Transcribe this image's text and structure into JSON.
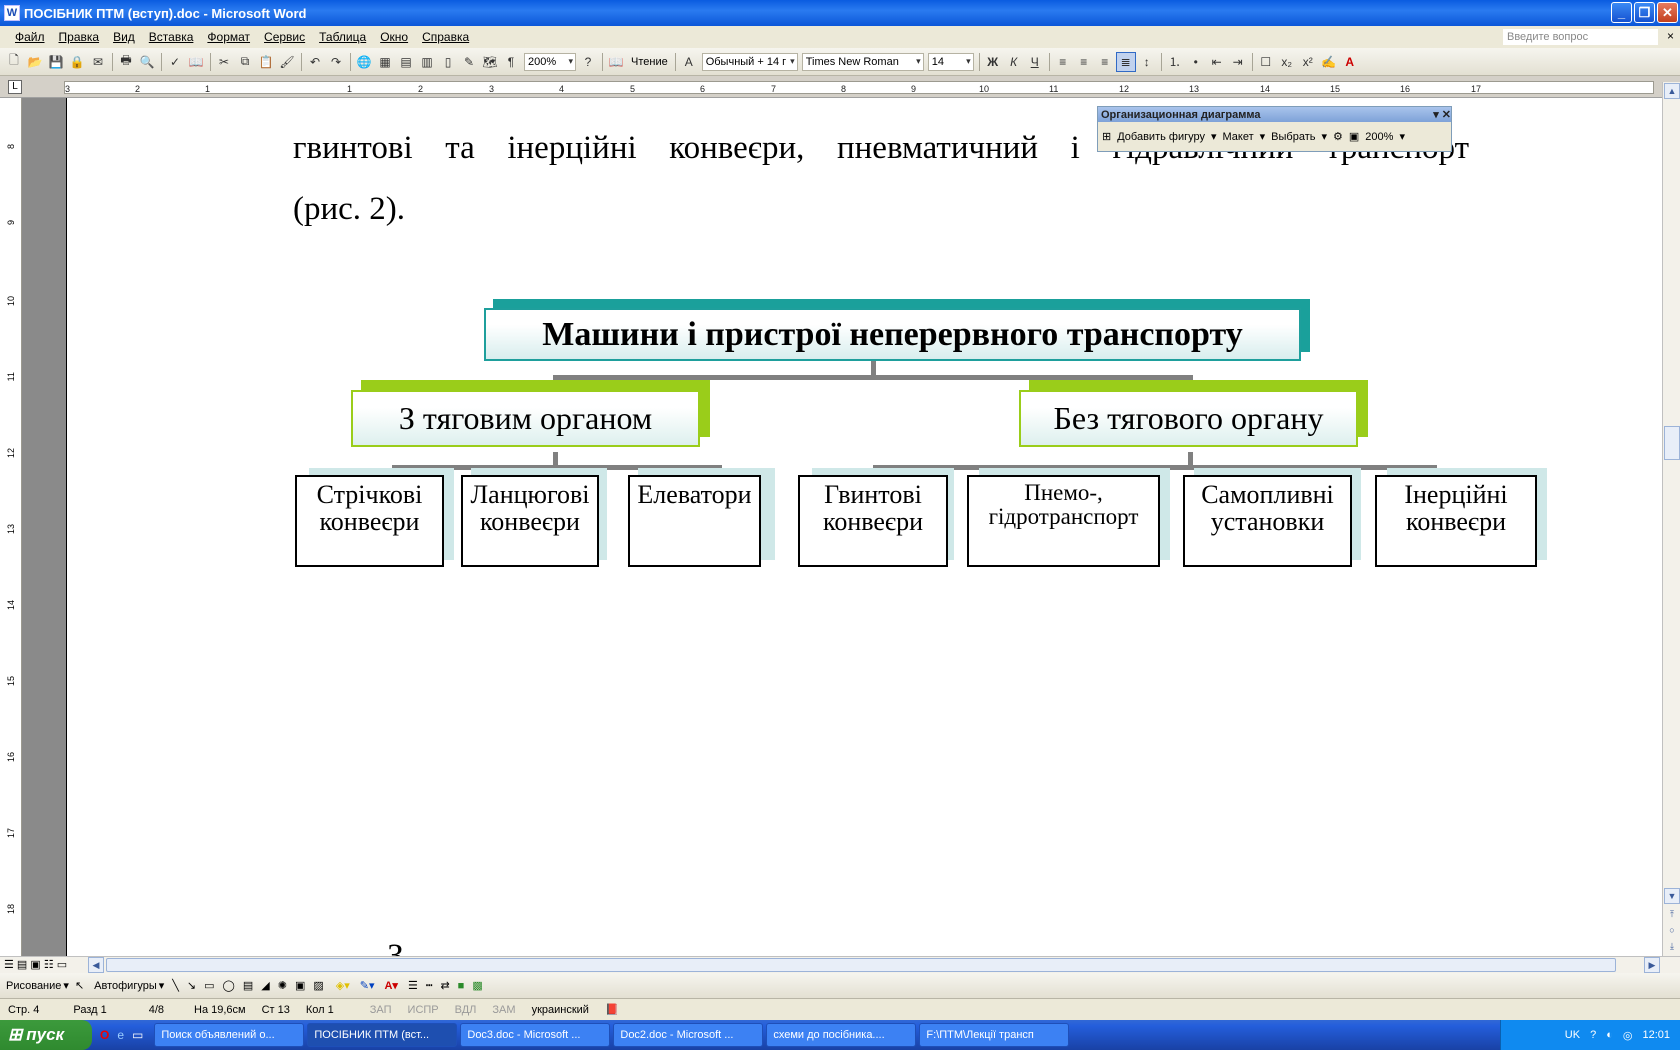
{
  "window": {
    "title": "ПОСІБНИК ПТМ (вступ).doc - Microsoft Word",
    "app_icon": "W"
  },
  "menu": {
    "items": [
      "Файл",
      "Правка",
      "Вид",
      "Вставка",
      "Формат",
      "Сервис",
      "Таблица",
      "Окно",
      "Справка"
    ],
    "help_placeholder": "Введите вопрос"
  },
  "toolbar": {
    "zoom": "200%",
    "reading": "Чтение",
    "style": "Обычный + 14 г",
    "font": "Times New Roman",
    "size": "14"
  },
  "ruler": {
    "top_ticks": [
      "3",
      "2",
      "1",
      "1",
      "2",
      "3",
      "4",
      "5",
      "6",
      "7",
      "8",
      "9",
      "10",
      "11",
      "12",
      "13",
      "14",
      "15",
      "16",
      "17"
    ],
    "left_ticks": [
      "8",
      "9",
      "10",
      "11",
      "12",
      "13",
      "14",
      "15",
      "16",
      "17",
      "18"
    ]
  },
  "document": {
    "line1": "гвинтові та інерційні конвеєри, пневматичний і гідравлічний транспорт",
    "line2": "(рис. 2).",
    "bottom_text": "З"
  },
  "orgchart": {
    "root": "Машини і пристрої неперервного транспорту",
    "left": "З тяговим органом",
    "right": "Без тягового органу",
    "leaves": [
      {
        "l1": "Стрічкові",
        "l2": "конвеєри"
      },
      {
        "l1": "Ланцюгові",
        "l2": "конвеєри"
      },
      {
        "l1": "Елеватори",
        "l2": ""
      },
      {
        "l1": "Гвинтові",
        "l2": "конвеєри"
      },
      {
        "l1": "Пнемо-,",
        "l2": "гідротранспорт"
      },
      {
        "l1": "Самопливні",
        "l2": "установки"
      },
      {
        "l1": "Інерційні",
        "l2": "конвеєри"
      }
    ]
  },
  "orgbar": {
    "title": "Организационная диаграмма",
    "add_shape": "Добавить фигуру",
    "layout": "Макет",
    "select": "Выбрать",
    "zoom": "200%"
  },
  "drawbar": {
    "drawing": "Рисование",
    "autoshapes": "Автофигуры"
  },
  "status": {
    "page": "Стр. 4",
    "section": "Разд 1",
    "pages": "4/8",
    "at": "На 19,6см",
    "line": "Ст 13",
    "col": "Кол 1",
    "rec": "ЗАП",
    "trk": "ИСПР",
    "ext": "ВДЛ",
    "ovr": "ЗАМ",
    "lang": "украинский"
  },
  "taskbar": {
    "start": "пуск",
    "tasks": [
      "Поиск объявлений о...",
      "ПОСІБНИК ПТМ (вст...",
      "Doc3.doc - Microsoft ...",
      "Doc2.doc - Microsoft ...",
      "схеми до посібника....",
      "F:\\ПТМ\\Лекції трансп"
    ],
    "lang": "UK",
    "clock": "12:01"
  }
}
